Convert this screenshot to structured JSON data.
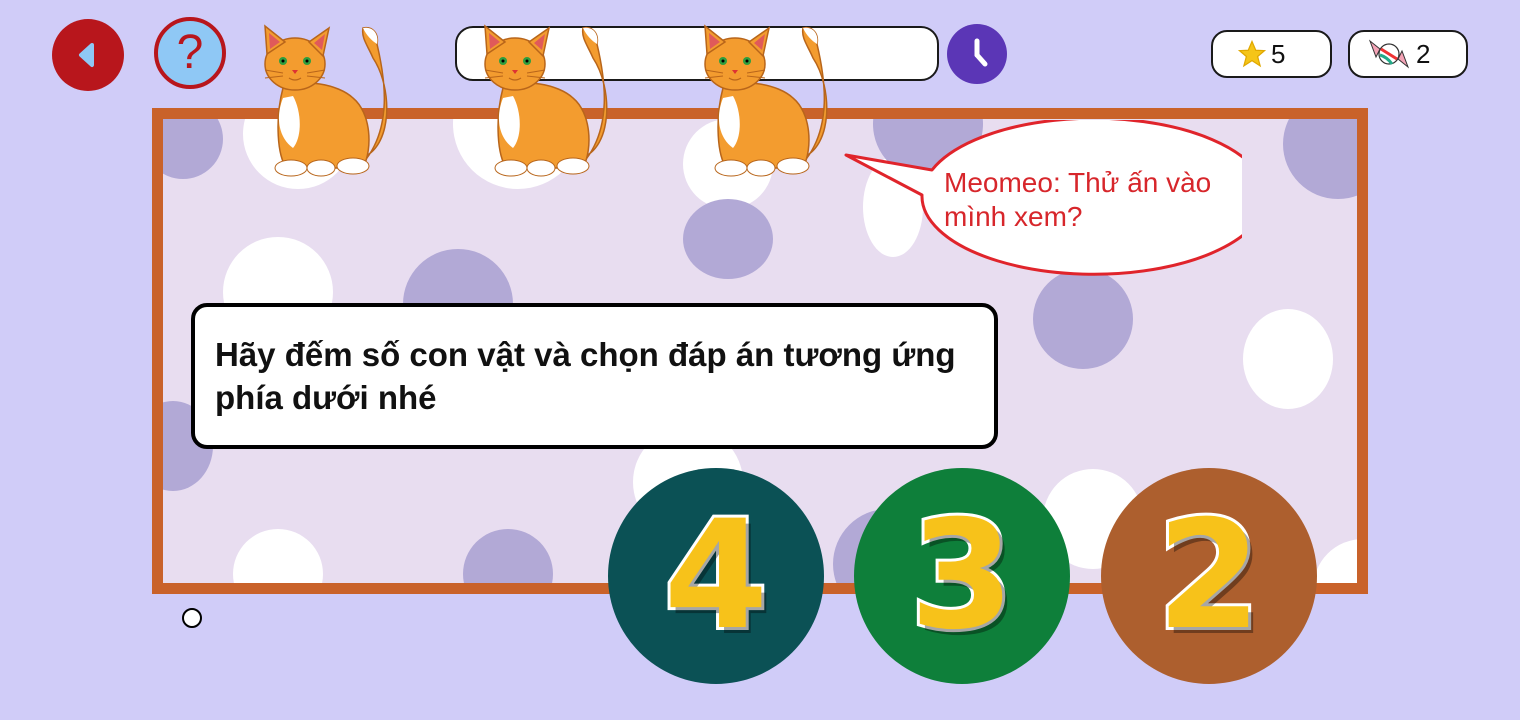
{
  "colors": {
    "background": "#d0ccf8",
    "board_frame": "#c9622a",
    "board_fill": "#e8ddf0",
    "back_button": "#b8161c",
    "help_button": "#8fc8f5",
    "timer_button": "#5b36b6",
    "bubble_text": "#d7262b",
    "answer_digit": "#f7c21a"
  },
  "header": {
    "back_icon": "back-arrow-icon",
    "help_label": "?",
    "progress_fraction": 0,
    "timer_icon": "clock-icon",
    "stars": {
      "icon": "star-icon",
      "value": "5"
    },
    "candies": {
      "icon": "candy-icon",
      "value": "2"
    }
  },
  "scene": {
    "cat_count": 3,
    "speech_bubble": "Meomeo: Thử ấn vào mình xem?"
  },
  "question": {
    "text": "Hãy đếm số con vật và chọn đáp án tương ứng phía dưới nhé"
  },
  "answers": [
    {
      "label": "4",
      "color": "#0b5155"
    },
    {
      "label": "3",
      "color": "#0e7f3a"
    },
    {
      "label": "2",
      "color": "#ad5f2e"
    }
  ]
}
